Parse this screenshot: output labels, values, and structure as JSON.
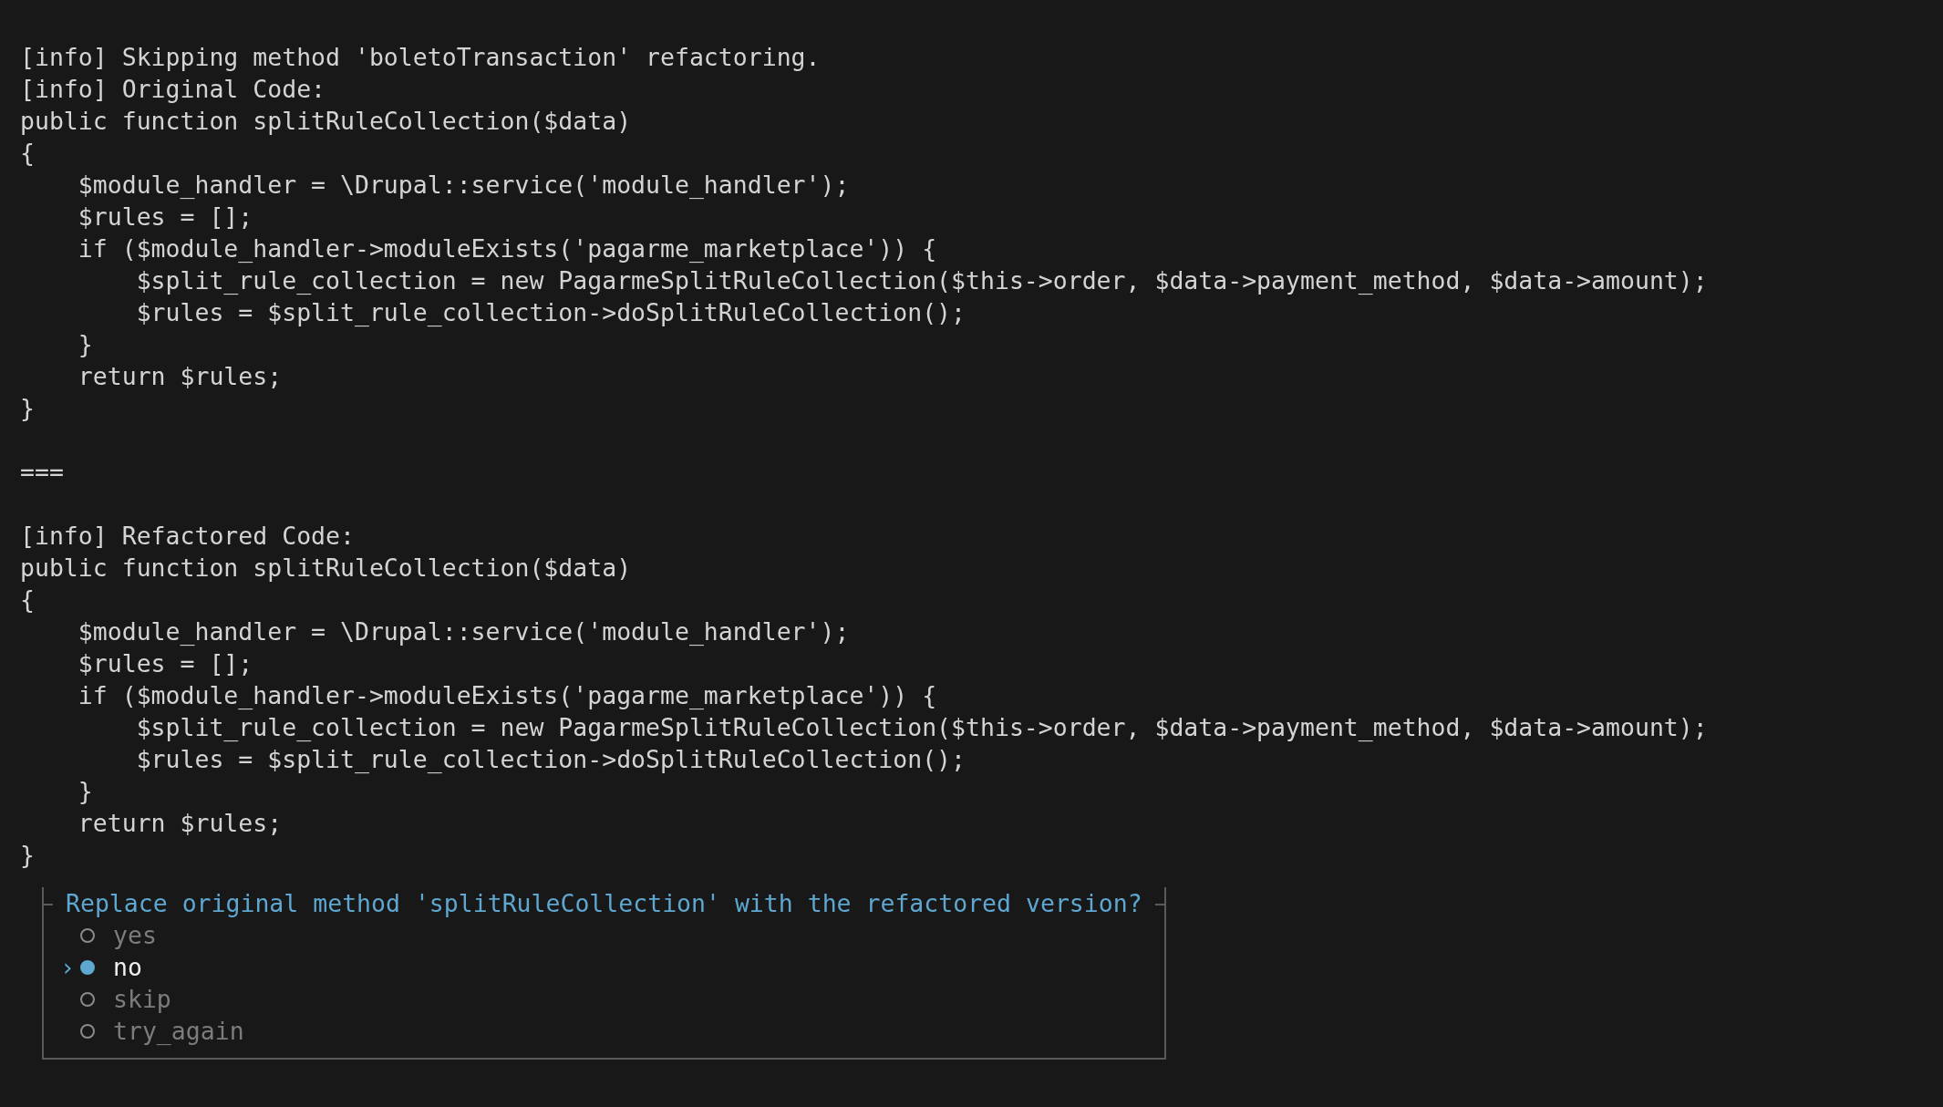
{
  "output_blocks": [
    [
      "[info] Skipping method 'boletoTransaction' refactoring.",
      "[info] Original Code:",
      "public function splitRuleCollection($data)",
      "{",
      "    $module_handler = \\Drupal::service('module_handler');",
      "    $rules = [];",
      "    if ($module_handler->moduleExists('pagarme_marketplace')) {",
      "        $split_rule_collection = new PagarmeSplitRuleCollection($this->order, $data->payment_method, $data->amount);",
      "        $rules = $split_rule_collection->doSplitRuleCollection();",
      "    }",
      "    return $rules;",
      "}"
    ],
    [
      "==="
    ],
    [
      "[info] Refactored Code:",
      "public function splitRuleCollection($data)",
      "{",
      "    $module_handler = \\Drupal::service('module_handler');",
      "    $rules = [];",
      "    if ($module_handler->moduleExists('pagarme_marketplace')) {",
      "        $split_rule_collection = new PagarmeSplitRuleCollection($this->order, $data->payment_method, $data->amount);",
      "        $rules = $split_rule_collection->doSplitRuleCollection();",
      "    }",
      "    return $rules;",
      "}"
    ]
  ],
  "prompt": {
    "question": "Replace original method 'splitRuleCollection' with the refactored version?",
    "pointer": "›",
    "options": [
      {
        "label": "yes",
        "selected": false
      },
      {
        "label": "no",
        "selected": true
      },
      {
        "label": "skip",
        "selected": false
      },
      {
        "label": "try_again",
        "selected": false
      }
    ]
  }
}
